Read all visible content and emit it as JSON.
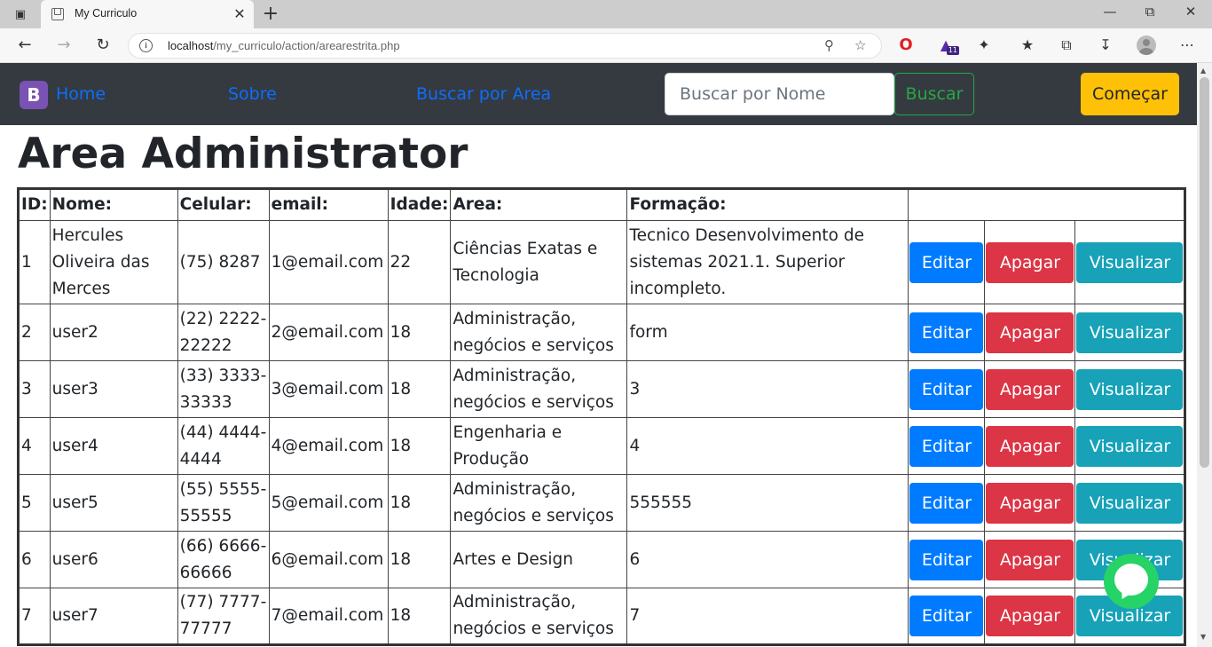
{
  "browser": {
    "tab_title": "My Curriculo",
    "url_host": "localhost",
    "url_path": "/my_curriculo/action/arearestrita.php",
    "extension_badge": "11"
  },
  "nav": {
    "brand": "B",
    "links": [
      "Home",
      "Sobre",
      "Buscar por Area"
    ],
    "search_placeholder": "Buscar por Nome",
    "search_button": "Buscar",
    "start_button": "Começar"
  },
  "page_title": "Area Administrator",
  "table": {
    "headers": [
      "ID:",
      "Nome:",
      "Celular:",
      "email:",
      "Idade:",
      "Area:",
      "Formação:"
    ],
    "actions": {
      "edit": "Editar",
      "delete": "Apagar",
      "view": "Visualizar"
    },
    "rows": [
      {
        "id": "1",
        "nome": "Hercules Oliveira das Merces",
        "celular": "(75) 8287",
        "email": "1@email.com",
        "idade": "22",
        "area": "Ciências Exatas e Tecnologia",
        "formacao": "Tecnico Desenvolvimento de sistemas 2021.1. Superior incompleto."
      },
      {
        "id": "2",
        "nome": "user2",
        "celular": "(22) 2222-22222",
        "email": "2@email.com",
        "idade": "18",
        "area": "Administração, negócios e serviços",
        "formacao": "form"
      },
      {
        "id": "3",
        "nome": "user3",
        "celular": "(33) 3333-33333",
        "email": "3@email.com",
        "idade": "18",
        "area": "Administração, negócios e serviços",
        "formacao": "3"
      },
      {
        "id": "4",
        "nome": "user4",
        "celular": "(44) 4444-4444",
        "email": "4@email.com",
        "idade": "18",
        "area": "Engenharia e Produção",
        "formacao": "4"
      },
      {
        "id": "5",
        "nome": "user5",
        "celular": "(55) 5555-55555",
        "email": "5@email.com",
        "idade": "18",
        "area": "Administração, negócios e serviços",
        "formacao": "555555"
      },
      {
        "id": "6",
        "nome": "user6",
        "celular": "(66) 6666-66666",
        "email": "6@email.com",
        "idade": "18",
        "area": "Artes e Design",
        "formacao": "6"
      },
      {
        "id": "7",
        "nome": "user7",
        "celular": "(77) 7777-77777",
        "email": "7@email.com",
        "idade": "18",
        "area": "Administração, negócios e serviços",
        "formacao": "7"
      }
    ]
  },
  "colors": {
    "navbar": "#343a40",
    "link": "#0d6efd",
    "edit": "#007bff",
    "delete": "#dc3545",
    "view": "#17a2b8",
    "start": "#ffc107",
    "search": "#28a745",
    "chat": "#25d366"
  }
}
